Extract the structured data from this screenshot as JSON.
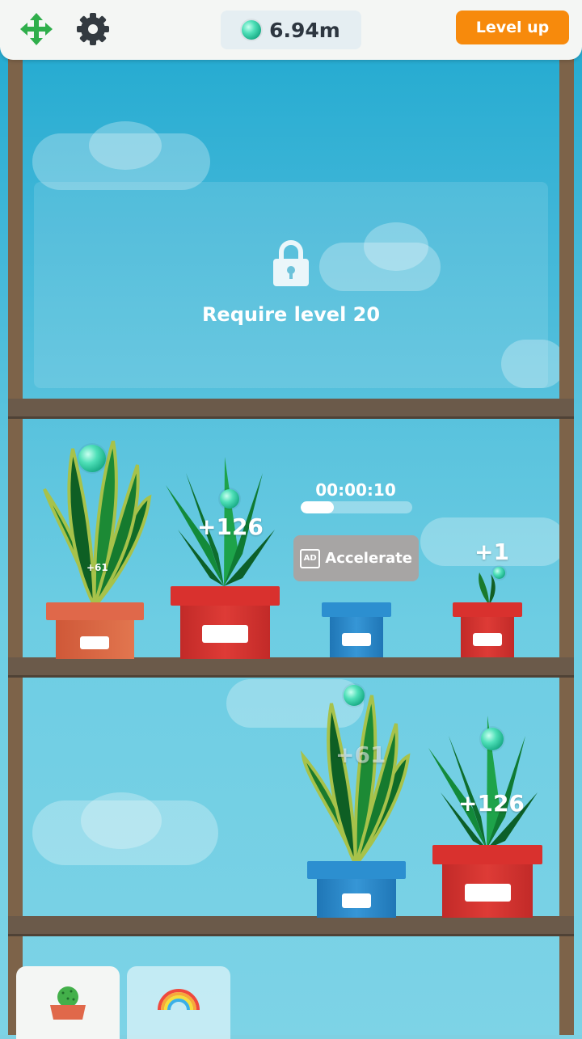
{
  "topbar": {
    "currency_value": "6.94m",
    "level_up_label": "Level up",
    "icons": [
      "move-arrows-icon",
      "gear-icon",
      "gem-icon"
    ]
  },
  "locked_shelf": {
    "message": "Require level 20",
    "icon": "lock-icon"
  },
  "shelf_2": {
    "plant_1": {
      "popup": "+61"
    },
    "plant_2": {
      "popup": "+126"
    },
    "slot_3": {
      "timer": "00:00:10",
      "progress": 0.3,
      "accelerate_label": "Accelerate",
      "ad_label": "AD"
    },
    "plant_4": {
      "popup": "+1"
    }
  },
  "shelf_3": {
    "plant_1": {
      "popup": "+61"
    },
    "plant_2": {
      "popup": "+126"
    }
  },
  "bottom_tabs": {
    "icons": [
      "cactus-pot-icon",
      "rainbow-icon"
    ],
    "active": 0
  },
  "colors": {
    "accent_orange": "#f78a0c",
    "gem_green": "#2ec89c",
    "shelf_brown": "#6b5a4a"
  }
}
